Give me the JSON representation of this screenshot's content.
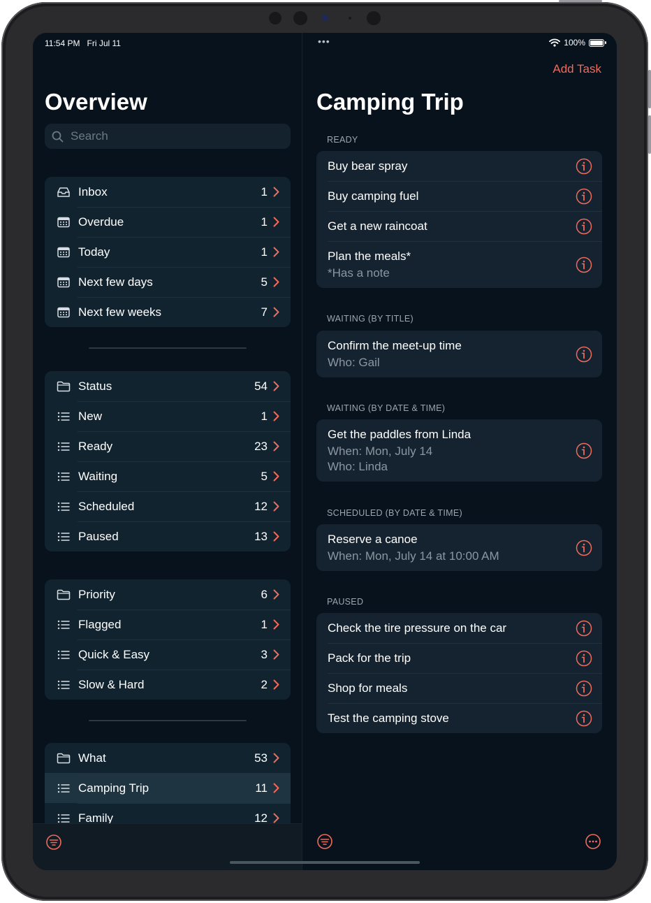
{
  "status_bar": {
    "time": "11:54 PM",
    "date": "Fri Jul 11",
    "dots": "•••",
    "battery": "100%",
    "battery_level": 1.0,
    "wifi_icon": "wifi-icon"
  },
  "sidebar": {
    "title": "Overview",
    "search_placeholder": "Search",
    "groups": [
      {
        "items": [
          {
            "label": "Inbox",
            "count": "1",
            "icon": "tray-icon"
          },
          {
            "label": "Overdue",
            "count": "1",
            "icon": "calendar-icon"
          },
          {
            "label": "Today",
            "count": "1",
            "icon": "calendar-icon"
          },
          {
            "label": "Next few days",
            "count": "5",
            "icon": "calendar-icon"
          },
          {
            "label": "Next few weeks",
            "count": "7",
            "icon": "calendar-icon"
          }
        ]
      },
      {
        "items": [
          {
            "label": "Status",
            "count": "54",
            "icon": "folder-icon"
          },
          {
            "label": "New",
            "count": "1",
            "icon": "list-icon"
          },
          {
            "label": "Ready",
            "count": "23",
            "icon": "list-icon"
          },
          {
            "label": "Waiting",
            "count": "5",
            "icon": "list-icon"
          },
          {
            "label": "Scheduled",
            "count": "12",
            "icon": "list-icon"
          },
          {
            "label": "Paused",
            "count": "13",
            "icon": "list-icon"
          }
        ]
      },
      {
        "items": [
          {
            "label": "Priority",
            "count": "6",
            "icon": "folder-icon"
          },
          {
            "label": "Flagged",
            "count": "1",
            "icon": "list-icon"
          },
          {
            "label": "Quick & Easy",
            "count": "3",
            "icon": "list-icon"
          },
          {
            "label": "Slow & Hard",
            "count": "2",
            "icon": "list-icon"
          }
        ]
      },
      {
        "items": [
          {
            "label": "What",
            "count": "53",
            "icon": "folder-icon"
          },
          {
            "label": "Camping Trip",
            "count": "11",
            "icon": "list-icon",
            "selected": true
          },
          {
            "label": "Family",
            "count": "12",
            "icon": "list-icon"
          }
        ]
      }
    ]
  },
  "detail": {
    "add_task": "Add Task",
    "title": "Camping Trip",
    "sections": [
      {
        "header": "READY",
        "tasks": [
          {
            "title": "Buy bear spray",
            "lines": []
          },
          {
            "title": "Buy camping fuel",
            "lines": []
          },
          {
            "title": "Get a new raincoat",
            "lines": []
          },
          {
            "title": "Plan the meals*",
            "lines": [
              "*Has a note"
            ]
          }
        ]
      },
      {
        "header": "WAITING (BY TITLE)",
        "tasks": [
          {
            "title": "Confirm the meet-up time",
            "lines": [
              "Who: Gail"
            ]
          }
        ]
      },
      {
        "header": "WAITING (BY DATE & TIME)",
        "tasks": [
          {
            "title": "Get the paddles from Linda",
            "lines": [
              "When: Mon, July 14",
              "Who: Linda"
            ]
          }
        ]
      },
      {
        "header": "SCHEDULED (BY DATE & TIME)",
        "tasks": [
          {
            "title": "Reserve a canoe",
            "lines": [
              "When: Mon, July 14 at 10:00 AM"
            ]
          }
        ]
      },
      {
        "header": "PAUSED",
        "tasks": [
          {
            "title": "Check the tire pressure on the car",
            "lines": []
          },
          {
            "title": "Pack for the trip",
            "lines": []
          },
          {
            "title": "Shop for meals",
            "lines": []
          },
          {
            "title": "Test the camping stove",
            "lines": []
          }
        ]
      }
    ]
  },
  "colors": {
    "accent": "#ef6b5c",
    "background": "#07121c",
    "cell": "#122330"
  },
  "toolbar": {
    "sidebar_filter_icon": "filter-icon",
    "detail_filter_icon": "filter-icon",
    "more_icon": "ellipsis-circle-icon"
  }
}
